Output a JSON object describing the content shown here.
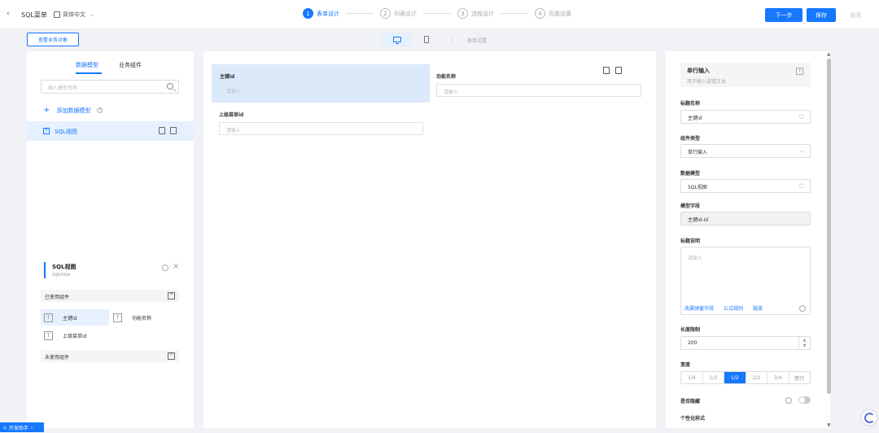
{
  "header": {
    "back_icon": "chevron-left-icon",
    "title": "SQL菜单",
    "language": "简体中文",
    "steps": [
      {
        "num": "1",
        "label": "表单设计",
        "active": true
      },
      {
        "num": "2",
        "label": "列表设计",
        "active": false
      },
      {
        "num": "3",
        "label": "流程设计",
        "active": false
      },
      {
        "num": "4",
        "label": "页面设置",
        "active": false
      }
    ],
    "next_label": "下一步",
    "save_label": "保存",
    "close_label": "关闭"
  },
  "subbar": {
    "view_business_objects": "查看业务对象",
    "form_setting": "表单设置"
  },
  "left": {
    "tabs": [
      "数据模型",
      "业务组件"
    ],
    "search_placeholder": "输入模型名称",
    "add_model": "添加数据模型",
    "model_item": "SQL视图",
    "detail": {
      "title": "SQL视图",
      "sub": "sqlview",
      "used_group": "已使用组件",
      "unused_group": "未使用组件",
      "used_items": [
        "主键id",
        "功能名称",
        "上级菜单id"
      ]
    }
  },
  "canvas": {
    "fields": [
      {
        "label": "主键id",
        "placeholder": "请输入"
      },
      {
        "label": "功能名称",
        "placeholder": "请输入"
      },
      {
        "label": "上级菜单id",
        "placeholder": "请输入"
      }
    ]
  },
  "right": {
    "card_title": "单行输入",
    "card_desc": "用于输入姿遗文本",
    "title_name_label": "标题名称",
    "title_name_value": "主键id",
    "component_type_label": "组件类型",
    "component_type_value": "单行输入",
    "data_model_label": "数据模型",
    "data_model_value": "SQL视图",
    "model_field_label": "模型字段",
    "model_field_value": "主键id-id",
    "title_desc_label": "标题说明",
    "title_desc_placeholder": "请输入",
    "links": [
      "改属弹窗字段",
      "公式规则",
      "链接"
    ],
    "length_label": "长度限制",
    "length_value": "200",
    "width_label": "宽度",
    "width_options": [
      "1/4",
      "1/3",
      "1/2",
      "2/3",
      "3/4",
      "整行"
    ],
    "width_selected": "1/2",
    "hidden_label": "是否隐藏",
    "hidden_on": false,
    "style_label": "个性化样式"
  },
  "footer": {
    "dev_assistant": "开发助手"
  },
  "colors": {
    "accent": "#1677ff",
    "selected_bg": "#e6f0ff"
  }
}
